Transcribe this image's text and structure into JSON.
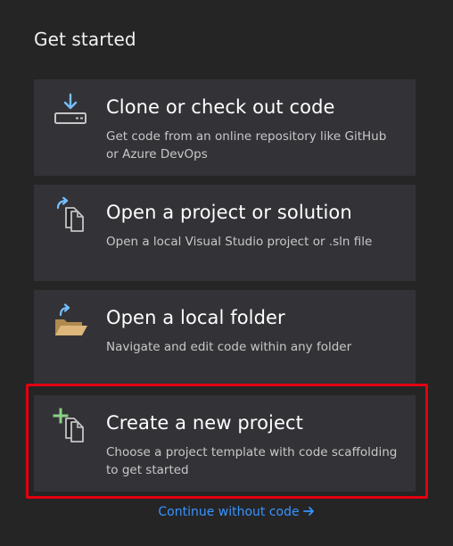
{
  "heading": "Get started",
  "cards": [
    {
      "title": "Clone or check out code",
      "description": "Get code from an online repository like GitHub or Azure DevOps",
      "icon": "download-to-drive-icon"
    },
    {
      "title": "Open a project or solution",
      "description": "Open a local Visual Studio project or .sln file",
      "icon": "open-project-icon"
    },
    {
      "title": "Open a local folder",
      "description": "Navigate and edit code within any folder",
      "icon": "open-folder-icon"
    },
    {
      "title": "Create a new project",
      "description": "Choose a project template with code scaffolding to get started",
      "icon": "new-project-icon"
    }
  ],
  "continue_link": "Continue without code",
  "colors": {
    "background": "#252526",
    "card": "#333337",
    "accent_blue": "#75beff",
    "link": "#3794ff",
    "highlight_red": "#e3000f",
    "folder_orange": "#dcb67a",
    "plus_green": "#89d185"
  }
}
